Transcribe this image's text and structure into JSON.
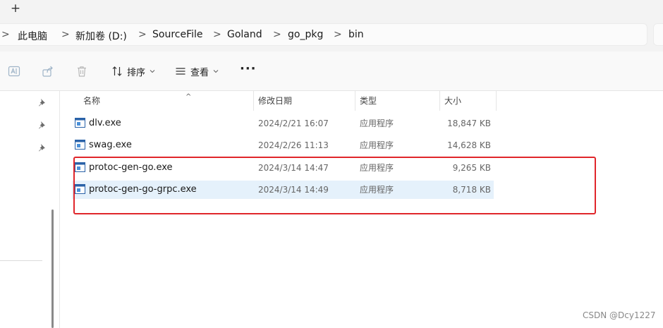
{
  "tabstrip": {
    "new_tab_glyph": "+"
  },
  "breadcrumb": {
    "items": [
      "此电脑",
      "新加卷 (D:)",
      "SourceFile",
      "Goland",
      "go_pkg",
      "bin"
    ],
    "separator": ">"
  },
  "toolbar": {
    "icons": [
      "rename-icon",
      "share-icon",
      "delete-icon"
    ],
    "sort_label": "排序",
    "view_label": "查看",
    "more_label": "···"
  },
  "columns": {
    "name": "名称",
    "date": "修改日期",
    "type": "类型",
    "size": "大小"
  },
  "files": [
    {
      "name": "dlv.exe",
      "date": "2024/2/21 16:07",
      "type": "应用程序",
      "size": "18,847 KB"
    },
    {
      "name": "swag.exe",
      "date": "2024/2/26 11:13",
      "type": "应用程序",
      "size": "14,628 KB"
    },
    {
      "name": "protoc-gen-go.exe",
      "date": "2024/3/14 14:47",
      "type": "应用程序",
      "size": "9,265 KB"
    },
    {
      "name": "protoc-gen-go-grpc.exe",
      "date": "2024/3/14 14:49",
      "type": "应用程序",
      "size": "8,718 KB"
    }
  ],
  "watermark": "CSDN @Dcy1227",
  "colors": {
    "selection": "#e5f1fb",
    "highlight_border": "#e0262b",
    "accent": "#0067c0"
  }
}
